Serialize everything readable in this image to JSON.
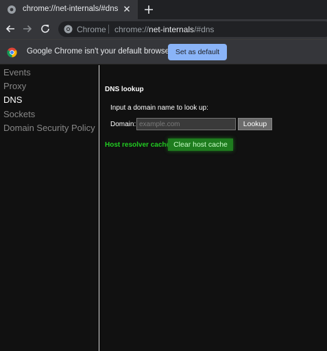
{
  "tab": {
    "title": "chrome://net-internals/#dns",
    "favicon": "globe-icon"
  },
  "toolbar": {
    "back_icon": "back-arrow-icon",
    "forward_icon": "forward-arrow-icon",
    "reload_icon": "reload-icon",
    "omnibox": {
      "site_label": "Chrome",
      "url_scheme": "chrome://",
      "url_host": "net-internals",
      "url_path": "/#dns"
    }
  },
  "infobar": {
    "message": "Google Chrome isn't your default browser",
    "button_label": "Set as default",
    "accent": "#8ab4f8"
  },
  "sidebar": {
    "items": [
      {
        "label": "Events",
        "active": false
      },
      {
        "label": "Proxy",
        "active": false
      },
      {
        "label": "DNS",
        "active": true
      },
      {
        "label": "Sockets",
        "active": false
      },
      {
        "label": "Domain Security Policy",
        "active": false
      }
    ]
  },
  "dns": {
    "title": "DNS lookup",
    "prompt": "Input a domain name to look up:",
    "domain_label": "Domain:",
    "domain_placeholder": "example.com",
    "domain_value": "",
    "lookup_label": "Lookup",
    "resolver_label": "Host resolver cache",
    "clear_cache_label": "Clear host cache",
    "resolver_color": "#22cc22"
  }
}
